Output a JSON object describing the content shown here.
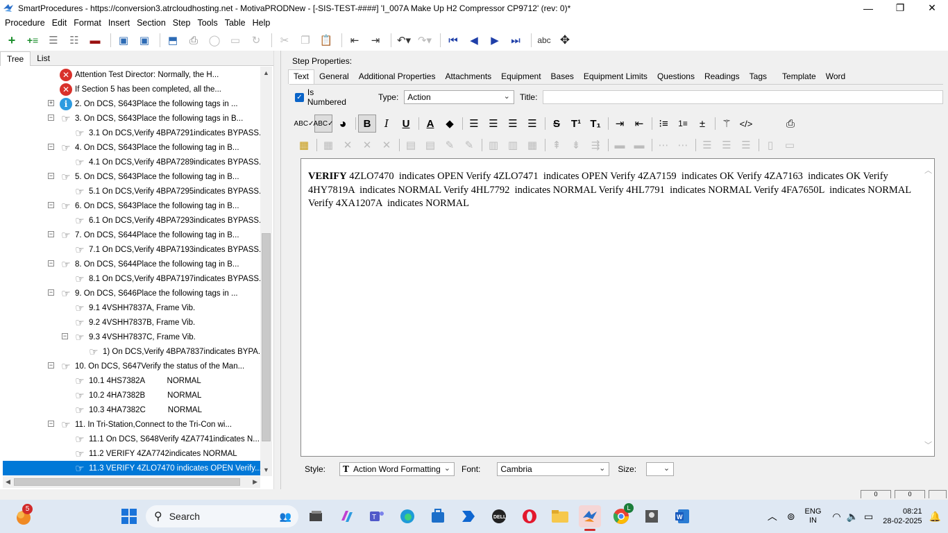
{
  "window": {
    "title": "SmartProcedures - https://conversion3.atrcloudhosting.net - MotivaPRODNew - [-SIS-TEST-####] 'I_007A Make Up H2 Compressor CP9712' (rev: 0)*",
    "minimize": "—",
    "maximize": "❐",
    "close": "✕"
  },
  "menu": {
    "items": [
      {
        "label": "Procedure"
      },
      {
        "label": "Edit"
      },
      {
        "label": "Format"
      },
      {
        "label": "Insert"
      },
      {
        "label": "Section"
      },
      {
        "label": "Step"
      },
      {
        "label": "Tools"
      },
      {
        "label": "Table"
      },
      {
        "label": "Help"
      }
    ]
  },
  "toolbar": {
    "icons": [
      "add-step-icon",
      "add-substep-icon",
      "indent-list-icon",
      "outdent-list-icon",
      "remove-icon",
      "save-all-icon",
      "save-icon",
      "upload-icon",
      "print-icon",
      "refresh-icon",
      "view-icon",
      "redo-special-icon",
      "cut-icon",
      "copy-icon",
      "paste-icon",
      "move-left-icon",
      "move-right-icon",
      "undo-icon",
      "redo-icon",
      "first-icon",
      "previous-icon",
      "next-icon",
      "last-icon",
      "spellcheck-icon",
      "move-icon"
    ]
  },
  "left_tabs": [
    {
      "label": "Tree"
    },
    {
      "label": "List"
    }
  ],
  "tree": {
    "rows": [
      {
        "text": "Attention Test Director: Normally, the H...",
        "icon": "error"
      },
      {
        "text": "If Section 5 has been completed, all the...",
        "icon": "error"
      },
      {
        "text": "2. On DCS, S643Place the following tags in ...",
        "icon": "info",
        "expander": "+"
      },
      {
        "text": "3. On DCS, S643Place the following tags in B...",
        "icon": "hand",
        "expander": "−"
      },
      {
        "text": "3.1  On DCS,Verify  4BPA7291indicates  BYPASS...",
        "icon": "hand"
      },
      {
        "text": "4. On DCS, S643Place the following tag in B...",
        "icon": "hand",
        "expander": "−"
      },
      {
        "text": "4.1  On DCS,Verify  4BPA7289indicates  BYPASS...",
        "icon": "hand"
      },
      {
        "text": "5. On DCS, S643Place the following tag in B...",
        "icon": "hand",
        "expander": "−"
      },
      {
        "text": "5.1  On DCS,Verify  4BPA7295indicates  BYPASS...",
        "icon": "hand"
      },
      {
        "text": "6. On DCS, S643Place the following tag in B...",
        "icon": "hand",
        "expander": "−"
      },
      {
        "text": "6.1  On DCS,Verify  4BPA7293indicates  BYPASS...",
        "icon": "hand"
      },
      {
        "text": "7. On DCS, S644Place the following tag in B...",
        "icon": "hand",
        "expander": "−"
      },
      {
        "text": "7.1  On DCS,Verify  4BPA7193indicates  BYPASS...",
        "icon": "hand"
      },
      {
        "text": "8. On DCS, S644Place the following tag in B...",
        "icon": "hand",
        "expander": "−"
      },
      {
        "text": "8.1  On DCS,Verify  4BPA7197indicates  BYPASS...",
        "icon": "hand"
      },
      {
        "text": "9. On DCS, S646Place the following tags in ...",
        "icon": "hand",
        "expander": "−"
      },
      {
        "text": "9.1 4VSHH7837A, Frame Vib.",
        "icon": "hand"
      },
      {
        "text": "9.2 4VSHH7837B, Frame Vib.",
        "icon": "hand"
      },
      {
        "text": "9.3 4VSHH7837C, Frame Vib.",
        "icon": "hand",
        "expander": "−"
      },
      {
        "text": "1)  On DCS,Verify  4BPA7837indicates  BYPA...",
        "icon": "hand"
      },
      {
        "text": "10. On DCS, S647Verify the status of the Man...",
        "icon": "hand",
        "expander": "−"
      },
      {
        "text": "10.1 4HS7382A          NORMAL",
        "icon": "hand"
      },
      {
        "text": "10.2 4HA7382B          NORMAL",
        "icon": "hand"
      },
      {
        "text": "10.3 4HA7382C          NORMAL",
        "icon": "hand"
      },
      {
        "text": "11. In Tri-Station,Connect to the Tri-Con wi...",
        "icon": "hand",
        "expander": "−"
      },
      {
        "text": "11.1  On DCS,  S648Verify  4ZA7741indicates  N...",
        "icon": "hand"
      },
      {
        "text": "11.2 VERIFY 4ZA7742indicates NORMAL",
        "icon": "hand"
      },
      {
        "text": "11.3 VERIFY 4ZLO7470  indicates OPEN Verify...",
        "icon": "hand",
        "selected": true
      }
    ]
  },
  "step_properties": {
    "label": "Step Properties:",
    "tabs": [
      {
        "label": "Text"
      },
      {
        "label": "General"
      },
      {
        "label": "Additional Properties"
      },
      {
        "label": "Attachments"
      },
      {
        "label": "Equipment"
      },
      {
        "label": "Bases"
      },
      {
        "label": "Equipment Limits"
      },
      {
        "label": "Questions"
      },
      {
        "label": "Readings"
      },
      {
        "label": "Tags"
      },
      {
        "label": "Template"
      },
      {
        "label": "Word"
      }
    ],
    "is_numbered_label": "Is Numbered",
    "type_label": "Type:",
    "type_value": "Action",
    "title_label": "Title:",
    "title_value": ""
  },
  "editor": {
    "bold_word": "VERIFY",
    "text": " 4ZLO7470  indicates OPEN Verify 4ZLO7471  indicates OPEN Verify 4ZA7159  indicates OK Verify 4ZA7163  indicates OK Verify 4HY7819A  indicates NORMAL Verify 4HL7792  indicates NORMAL Verify 4HL7791  indicates NORMAL Verify 4FA7650L  indicates NORMAL Verify 4XA1207A  indicates NORMAL"
  },
  "format_bar": {
    "bold": "B",
    "italic": "I",
    "underline": "U",
    "font_color": "A",
    "strike": "S",
    "superscript": "T¹",
    "subscript": "T₁",
    "code": "</>"
  },
  "bottom": {
    "style_label": "Style:",
    "style_value": "Action Word Formatting",
    "style_glyph": "T",
    "font_label": "Font:",
    "font_value": "Cambria",
    "size_label": "Size:",
    "size_value": ""
  },
  "status": {
    "box1": "0",
    "box2": "0"
  },
  "taskbar": {
    "search_label": "Search",
    "notification_badge": "5",
    "chrome_badge": "L",
    "lang_line1": "ENG",
    "lang_line2": "IN",
    "time": "08:21",
    "date": "28-02-2025"
  },
  "colors": {
    "selection": "#0078d7",
    "checkbox": "#0a64c8",
    "error": "#d9312b",
    "info": "#2d9be0",
    "taskbar": "#dfe8f3"
  }
}
